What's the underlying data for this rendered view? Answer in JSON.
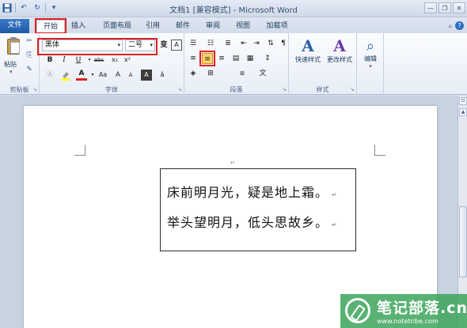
{
  "window": {
    "title": "文档1 [兼容模式] - Microsoft Word",
    "qat_icons": [
      "save-icon",
      "undo-icon",
      "redo-icon",
      "customize-icon"
    ]
  },
  "tabs": [
    {
      "label": "文件"
    },
    {
      "label": "开始"
    },
    {
      "label": "插入"
    },
    {
      "label": "页面布局"
    },
    {
      "label": "引用"
    },
    {
      "label": "邮件"
    },
    {
      "label": "审阅"
    },
    {
      "label": "视图"
    },
    {
      "label": "加载项"
    }
  ],
  "active_tab": "开始",
  "ribbon": {
    "clipboard": {
      "paste_label": "粘贴",
      "group_label": "剪贴板"
    },
    "font": {
      "font_name": "黑体",
      "font_size": "二号",
      "group_label": "字体",
      "buttons": [
        "B",
        "I",
        "U",
        "abc",
        "x₂",
        "x²",
        "A",
        "Aa",
        "A",
        "A",
        "A",
        "变",
        "A"
      ]
    },
    "paragraph": {
      "group_label": "段落"
    },
    "styles": {
      "quick_styles_label": "快速样式",
      "change_styles_label": "更改样式",
      "group_label": "样式"
    },
    "editing": {
      "label": "编辑"
    }
  },
  "document": {
    "lines": [
      "床前明月光，疑是地上霜。",
      "举头望明月，低头思故乡。"
    ],
    "paragraph_mark": "↵"
  },
  "watermark": {
    "main": "笔记部落.cn",
    "sub": "www.notetribe.com"
  },
  "colors": {
    "file_tab": "#2a64b2",
    "highlight_box": "#e02020",
    "selected_button": "#fbd26b",
    "watermark": "#3ca55a"
  }
}
